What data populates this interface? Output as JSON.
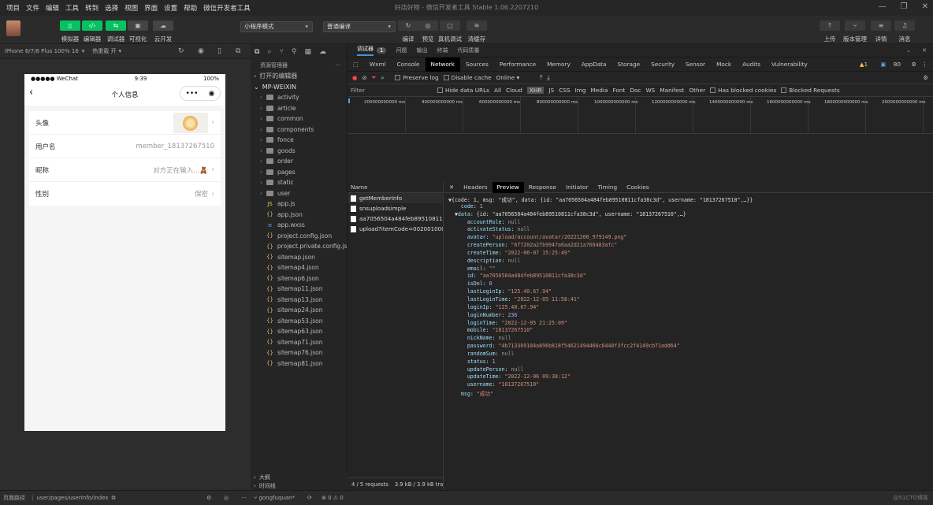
{
  "menubar": {
    "items": [
      "项目",
      "文件",
      "编辑",
      "工具",
      "转到",
      "选择",
      "视图",
      "界面",
      "设置",
      "帮助",
      "微信开发者工具"
    ],
    "window_title": "好店好物 - 微信开发者工具 Stable 1.06.2207210"
  },
  "toolbar": {
    "left_buttons": [
      {
        "label": "模拟器",
        "icon": "phone-icon"
      },
      {
        "label": "编辑器",
        "icon": "code-icon"
      },
      {
        "label": "调试器",
        "icon": "debug-icon"
      },
      {
        "label": "可视化",
        "icon": "layout-icon"
      },
      {
        "label": "云开发",
        "icon": "cloud-icon"
      }
    ],
    "mode_select": "小程序模式",
    "compile_select": "普通编译",
    "mid_buttons": [
      {
        "label": "编译"
      },
      {
        "label": "预览"
      },
      {
        "label": "真机调试"
      },
      {
        "label": "清缓存"
      }
    ],
    "right_buttons": [
      {
        "label": "上传"
      },
      {
        "label": "版本管理"
      },
      {
        "label": "详情"
      },
      {
        "label": "消息"
      }
    ]
  },
  "simulator": {
    "device": "iPhone 6/7/8 Plus 100% 16",
    "hot_reload": "热重载 开",
    "status": {
      "carrier": "●●●●● WeChat",
      "time": "9:39",
      "battery": "100%"
    },
    "nav_title": "个人信息",
    "rows": [
      {
        "label": "头像",
        "value": ""
      },
      {
        "label": "用户名",
        "value": "member_18137267510"
      },
      {
        "label": "昵称",
        "value": "对方正在输入...🧸"
      },
      {
        "label": "性别",
        "value": "保密"
      }
    ]
  },
  "explorer": {
    "title": "资源管理器",
    "open_editors": "打开的编辑器",
    "project": "MP-WEIXIN",
    "folders": [
      "activity",
      "article",
      "common",
      "components",
      "fonce",
      "goods",
      "order",
      "pages",
      "static",
      "user"
    ],
    "files": [
      "app.js",
      "app.json",
      "app.wxss",
      "project.config.json",
      "project.private.config.js...",
      "sitemap.json",
      "sitemap4.json",
      "sitemap6.json",
      "sitemap11.json",
      "sitemap13.json",
      "sitemap24.json",
      "sitemap53.json",
      "sitemap63.json",
      "sitemap71.json",
      "sitemap76.json",
      "sitemap81.json"
    ],
    "outline": "大纲",
    "timeline": "时间线"
  },
  "devtools": {
    "top_tabs": [
      "调试器",
      "1",
      "问题",
      "输出",
      "终端",
      "代码质量"
    ],
    "panels": [
      "Wxml",
      "Console",
      "Network",
      "Sources",
      "Performance",
      "Memory",
      "AppData",
      "Storage",
      "Security",
      "Sensor",
      "Mock",
      "Audits",
      "Vulnerability"
    ],
    "warn": "▲1",
    "errors": "80",
    "net": {
      "preserve": "Preserve log",
      "disable": "Disable cache",
      "online": "Online"
    },
    "filter": {
      "label": "Filter",
      "hide": "Hide data URLs",
      "types": [
        "All",
        "Cloud",
        "XHR",
        "JS",
        "CSS",
        "Img",
        "Media",
        "Font",
        "Doc",
        "WS",
        "Manifest",
        "Other"
      ],
      "blocked_cookies": "Has blocked cookies",
      "blocked_req": "Blocked Requests"
    },
    "ticks": [
      "200000000000 ms",
      "400000000000 ms",
      "600000000000 ms",
      "800000000000 ms",
      "1000000000000 ms",
      "1200000000000 ms",
      "1400000000000 ms",
      "1600000000000 ms",
      "1800000000000 ms",
      "2000000000000 ms"
    ],
    "name_header": "Name",
    "requests": [
      "getMemberInfo",
      "snsuploadsimple",
      "aa7056504a484feb89510811cf...",
      "upload?itemCode=002001000..."
    ],
    "footer": {
      "requests": "4 / 5 requests",
      "size": "3.9 kB / 3.9 kB tra"
    },
    "detail_tabs": [
      "Headers",
      "Preview",
      "Response",
      "Initiator",
      "Timing",
      "Cookies"
    ]
  },
  "json_lines": [
    "▼{code: 1, msg: \"成功\", data: {id: \"aa7056504a484feb89510811cfa38c3d\", username: \"18137267510\",…}}",
    "    code: 1",
    "  ▼data: {id: \"aa7056504a484feb89510811cfa38c3d\", username: \"18137267510\",…}",
    "      accountRole: null",
    "      activateStatus: null",
    "      avatar: \"upload/account/avatar/20221206_979149.png\"",
    "      createPerson: \"6f7202a2fb9947a6aa2d21a766483afc\"",
    "      createTime: \"2022-06-07 15:25:49\"",
    "      description: null",
    "      email: \"\"",
    "      id: \"aa7056504a484feb89510811cfa38c3d\"",
    "      isDel: 0",
    "      lastLoginIp: \"125.40.67.94\"",
    "      lastLoginTime: \"2022-12-05 11:58:41\"",
    "      loginIp: \"125.40.67.94\"",
    "      loginNumber: 236",
    "      loginTime: \"2022-12-05 21:25:09\"",
    "      mobile: \"18137267510\"",
    "      nickName: null",
    "      password: \"4b713369184a896b818f54621494466c6440f3fcc2f4149cb71add64\"",
    "      randomSum: null",
    "      status: 1",
    "      updatePerson: null",
    "      updateTime: \"2022-12-06 09:38:12\"",
    "      username: \"18137267510\"",
    "    msg: \"成功\""
  ],
  "bottom": {
    "path_label": "页面路径",
    "path": "user/pages/userInfo/index",
    "user": "gongfuquan*",
    "errs": "⊗ 0 ⚠ 0",
    "watermark": "@51CTO博客"
  }
}
